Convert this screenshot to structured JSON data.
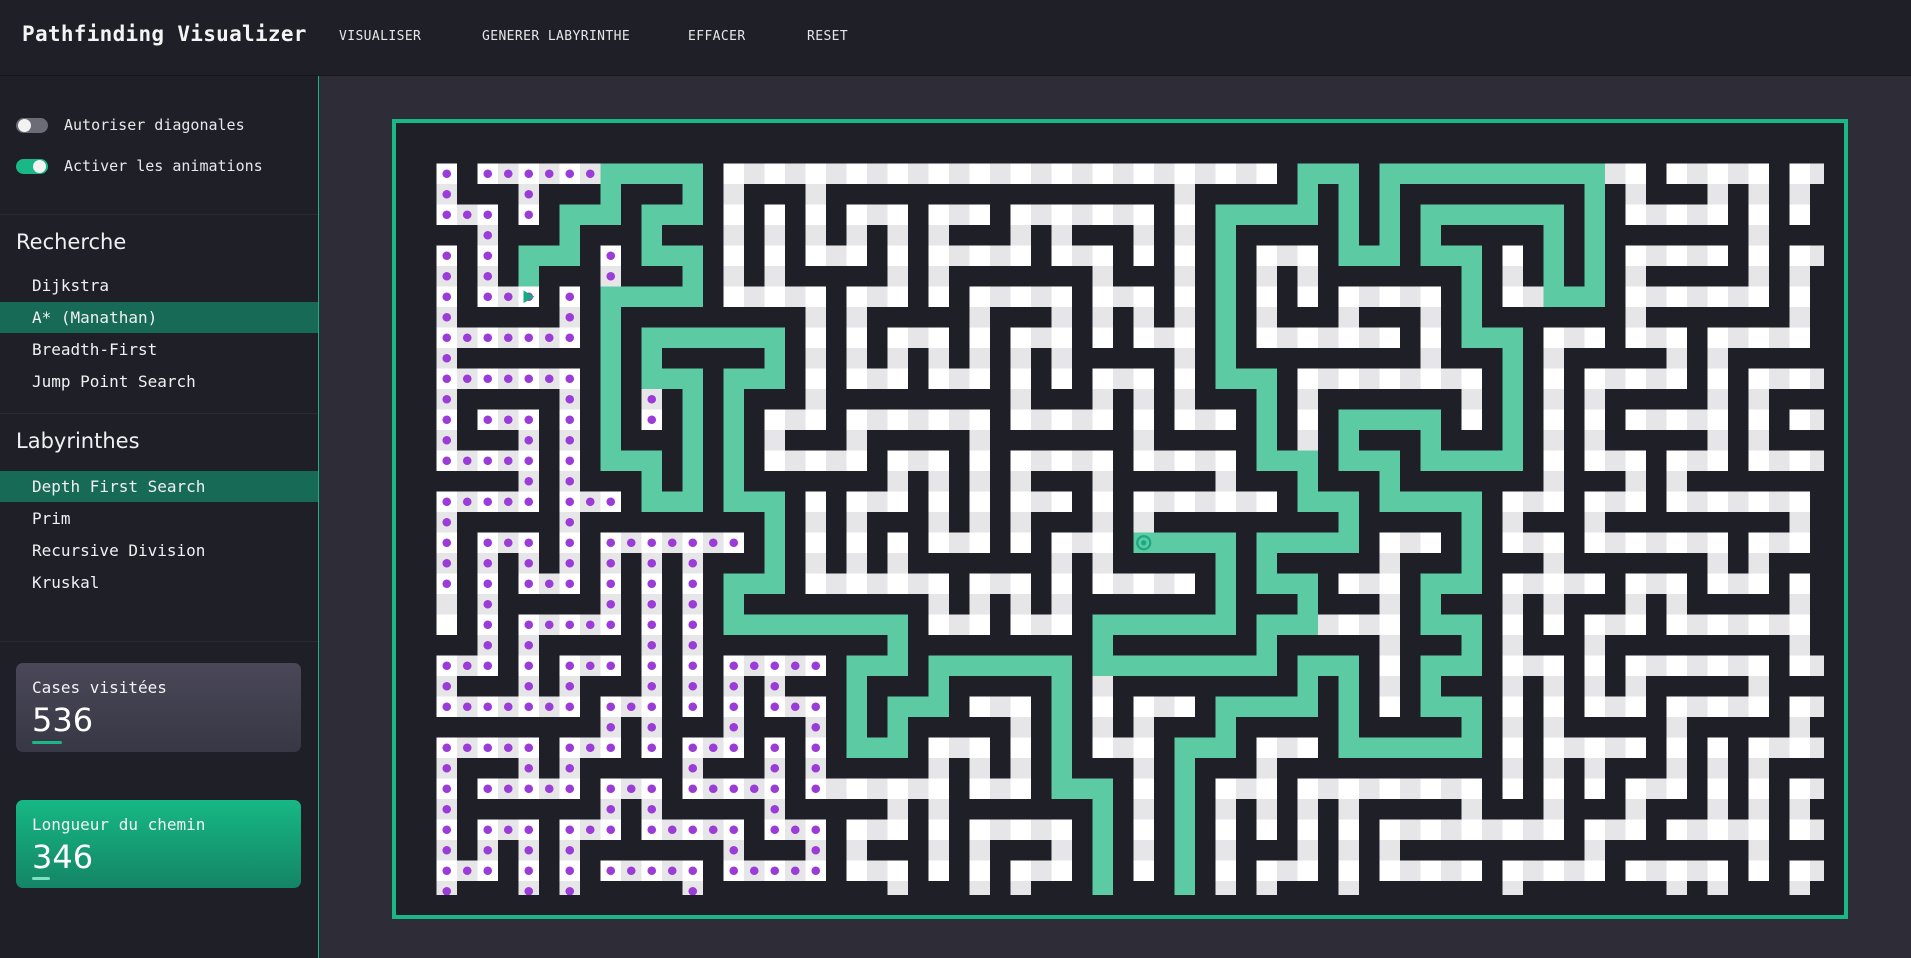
{
  "app": {
    "title": "Pathfinding Visualizer",
    "actions": [
      "VISUALISER",
      "GENERER LABYRINTHE",
      "EFFACER",
      "RESET"
    ]
  },
  "options": {
    "diagonals": {
      "label": "Autoriser diagonales",
      "enabled": false
    },
    "animations": {
      "label": "Activer les animations",
      "enabled": true
    }
  },
  "search": {
    "title": "Recherche",
    "items": [
      "Dijkstra",
      "A* (Manathan)",
      "Breadth-First",
      "Jump Point Search"
    ],
    "selected": "A* (Manathan)"
  },
  "mazes": {
    "title": "Labyrinthes",
    "items": [
      "Depth First Search",
      "Prim",
      "Recursive Division",
      "Kruskal"
    ],
    "selected": "Depth First Search"
  },
  "stats": {
    "visited": {
      "label": "Cases visitées",
      "value": "536"
    },
    "path": {
      "label": "Longueur du chemin",
      "value": "346"
    }
  },
  "colors": {
    "wall": "#1f1f27",
    "open": "#ffffff",
    "open_alt": "#e6e6e8",
    "path": "#5ccaa3",
    "visited_dot": "#9b3bd8",
    "accent": "#19b886",
    "start_icon": "#19a880",
    "end_icon": "#19a880"
  },
  "icons": {
    "start": "play-triangle-icon",
    "end": "target-icon"
  }
}
